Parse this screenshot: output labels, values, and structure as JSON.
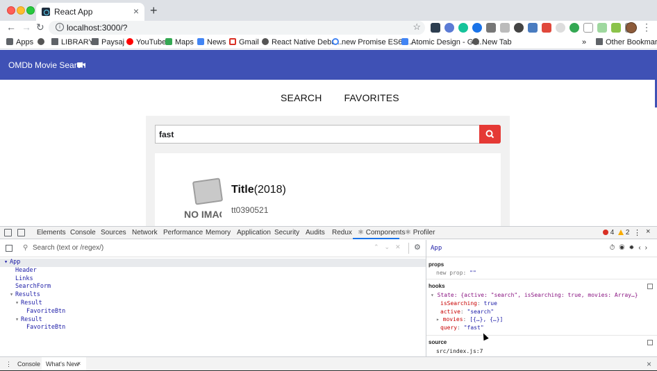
{
  "browser": {
    "tab_title": "React App",
    "tab_close": "×",
    "new_tab": "+",
    "url": "localhost:3000/?",
    "bookmarks": [
      "Apps",
      "LIBRARY",
      "Paysaj",
      "YouTube",
      "Maps",
      "News",
      "Gmail",
      "React Native Debu...",
      "new Promise ES6 -...",
      "Atomic Design - Go...",
      "New Tab"
    ],
    "bookmarks_more": "»",
    "other_bookmarks": "Other Bookmarks"
  },
  "app": {
    "title": "OMDb Movie Search",
    "nav": [
      "SEARCH",
      "FAVORITES"
    ],
    "search_value": "fast",
    "result": {
      "title": "Title",
      "year": "(2018)",
      "id": "tt0390521",
      "no_image_text": "NO IMAGE AVAILABLE"
    }
  },
  "devtools": {
    "tabs": [
      "Elements",
      "Console",
      "Sources",
      "Network",
      "Performance",
      "Memory",
      "Application",
      "Security",
      "Audits",
      "Redux",
      "⚛ Components",
      "⚛ Profiler"
    ],
    "errors": "4",
    "warnings": "2",
    "search_placeholder": "Search (text or /regex/)",
    "tree": [
      {
        "indent": 0,
        "caret": "▾",
        "name": "App",
        "selected": true
      },
      {
        "indent": 1,
        "caret": "",
        "name": "Header",
        "selected": false
      },
      {
        "indent": 1,
        "caret": "",
        "name": "Links",
        "selected": false
      },
      {
        "indent": 1,
        "caret": "",
        "name": "SearchForm",
        "selected": false
      },
      {
        "indent": 1,
        "caret": "▾",
        "name": "Results",
        "selected": false
      },
      {
        "indent": 2,
        "caret": "▾",
        "name": "Result",
        "selected": false
      },
      {
        "indent": 3,
        "caret": "",
        "name": "FavoriteBtn",
        "selected": false
      },
      {
        "indent": 2,
        "caret": "▾",
        "name": "Result",
        "selected": false
      },
      {
        "indent": 3,
        "caret": "",
        "name": "FavoriteBtn",
        "selected": false
      }
    ],
    "inspector": {
      "component": "App",
      "props_title": "props",
      "props_line_key": "new prop",
      "props_line_value": "\"\"",
      "hooks_title": "hooks",
      "state_summary": "State: {active: \"search\", isSearching: true, movies: Array…}",
      "isSearching_key": "isSearching",
      "isSearching_val": "true",
      "active_key": "active",
      "active_val": "\"search\"",
      "movies_key": "movies",
      "movies_val": "[{…}, {…}]",
      "query_key": "query",
      "query_val": "\"fast\"",
      "source_title": "source",
      "source_val": "src/index.js:7"
    },
    "drawer": [
      "Console",
      "What's New"
    ],
    "drawer_close": "×"
  }
}
